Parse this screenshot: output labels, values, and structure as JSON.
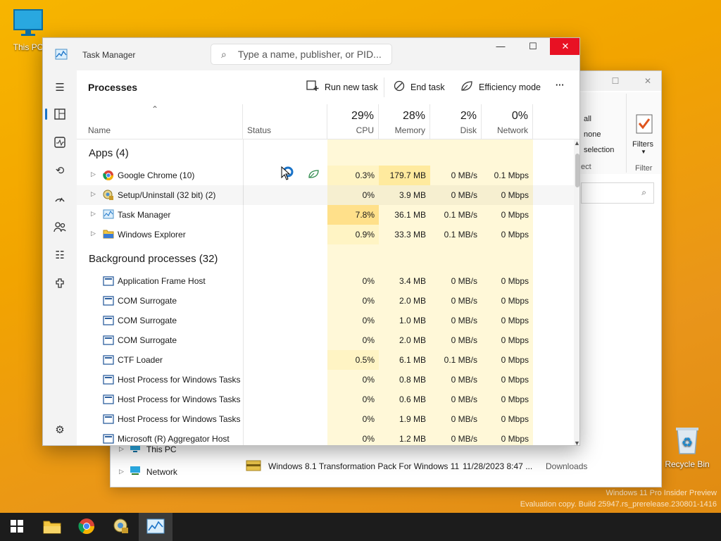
{
  "desktop": {
    "this_pc_label": "This PC",
    "recycle_label": "Recycle Bin",
    "watermark_line1": "Windows 11 Pro Insider Preview",
    "watermark_line2": "Evaluation copy. Build 25947.rs_prerelease.230801-1416"
  },
  "explorer": {
    "ribbon": {
      "select_all": "all",
      "select_none": "none",
      "invert": "selection",
      "group_label": "ect",
      "filters": "Filters",
      "filter_group": "Filter"
    },
    "tree": [
      "This PC",
      "Network"
    ],
    "file": {
      "name": "Windows 8.1 Transformation Pack For Windows 11",
      "date": "11/28/2023 8:47 ...",
      "folder": "Downloads"
    }
  },
  "taskmanager": {
    "title": "Task Manager",
    "search_placeholder": "Type a name, publisher, or PID...",
    "window": {
      "min": "—",
      "max": "☐",
      "close": "✕"
    },
    "page_title": "Processes",
    "toolbar": {
      "run_new_task": "Run new task",
      "end_task": "End task",
      "efficiency_mode": "Efficiency mode",
      "more": "···"
    },
    "columns": {
      "name": "Name",
      "status": "Status",
      "cpu_pct": "29%",
      "cpu": "CPU",
      "mem_pct": "28%",
      "mem": "Memory",
      "disk_pct": "2%",
      "disk": "Disk",
      "net_pct": "0%",
      "net": "Network"
    },
    "groups": {
      "apps": "Apps (4)",
      "background": "Background processes (32)"
    },
    "apps": [
      {
        "name": "Google Chrome (10)",
        "cpu": "0.3%",
        "mem": "179.7 MB",
        "disk": "0 MB/s",
        "net": "0.1 Mbps",
        "icon": "chrome-icon"
      },
      {
        "name": "Setup/Uninstall (32 bit) (2)",
        "cpu": "0%",
        "mem": "3.9 MB",
        "disk": "0 MB/s",
        "net": "0 Mbps",
        "icon": "setup-icon"
      },
      {
        "name": "Task Manager",
        "cpu": "7.8%",
        "mem": "36.1 MB",
        "disk": "0.1 MB/s",
        "net": "0 Mbps",
        "icon": "taskmanager-icon"
      },
      {
        "name": "Windows Explorer",
        "cpu": "0.9%",
        "mem": "33.3 MB",
        "disk": "0.1 MB/s",
        "net": "0 Mbps",
        "icon": "folder-icon"
      }
    ],
    "background": [
      {
        "name": "Application Frame Host",
        "cpu": "0%",
        "mem": "3.4 MB",
        "disk": "0 MB/s",
        "net": "0 Mbps"
      },
      {
        "name": "COM Surrogate",
        "cpu": "0%",
        "mem": "2.0 MB",
        "disk": "0 MB/s",
        "net": "0 Mbps"
      },
      {
        "name": "COM Surrogate",
        "cpu": "0%",
        "mem": "1.0 MB",
        "disk": "0 MB/s",
        "net": "0 Mbps"
      },
      {
        "name": "COM Surrogate",
        "cpu": "0%",
        "mem": "2.0 MB",
        "disk": "0 MB/s",
        "net": "0 Mbps"
      },
      {
        "name": "CTF Loader",
        "cpu": "0.5%",
        "mem": "6.1 MB",
        "disk": "0.1 MB/s",
        "net": "0 Mbps"
      },
      {
        "name": "Host Process for Windows Tasks",
        "cpu": "0%",
        "mem": "0.8 MB",
        "disk": "0 MB/s",
        "net": "0 Mbps"
      },
      {
        "name": "Host Process for Windows Tasks",
        "cpu": "0%",
        "mem": "0.6 MB",
        "disk": "0 MB/s",
        "net": "0 Mbps"
      },
      {
        "name": "Host Process for Windows Tasks",
        "cpu": "0%",
        "mem": "1.9 MB",
        "disk": "0 MB/s",
        "net": "0 Mbps"
      },
      {
        "name": "Microsoft (R) Aggregator Host",
        "cpu": "0%",
        "mem": "1.2 MB",
        "disk": "0 MB/s",
        "net": "0 Mbps"
      }
    ]
  },
  "colors": {
    "heat_light": "#fff4c4",
    "heat_mid": "#ffea9e",
    "heat_strong": "#ffe08a",
    "accent": "#1a73c8",
    "close_red": "#e81123"
  },
  "taskbar": {
    "apps": [
      "start-icon",
      "file-explorer-icon",
      "chrome-icon",
      "setup-icon",
      "taskmanager-icon"
    ]
  }
}
